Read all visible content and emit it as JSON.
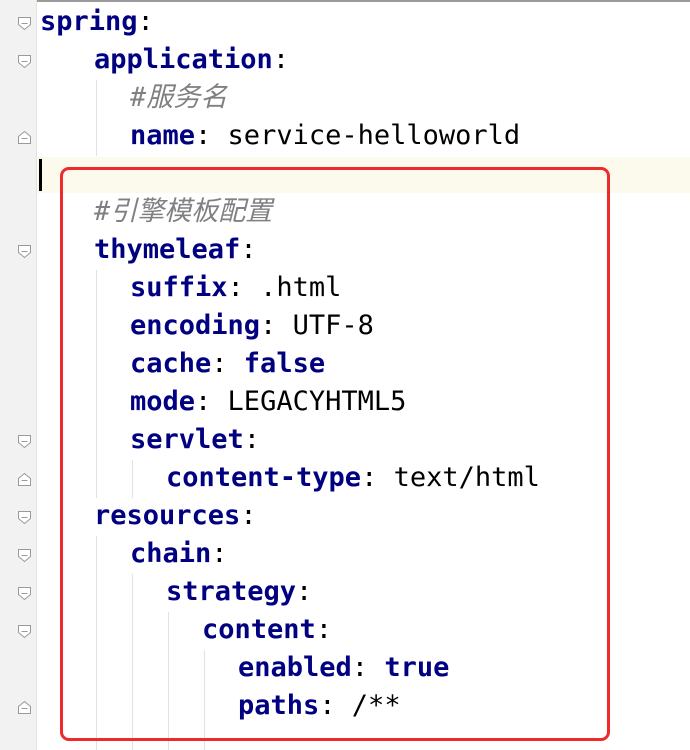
{
  "lines": [
    {
      "key": "spring",
      "colon": ":"
    },
    {
      "key": "application",
      "colon": ":"
    },
    {
      "comment": "#服务名"
    },
    {
      "key": "name",
      "colon": ":",
      "value": " service-helloworld"
    },
    {
      "blank": ""
    },
    {
      "comment": "#引擎模板配置"
    },
    {
      "key": "thymeleaf",
      "colon": ":"
    },
    {
      "key": "suffix",
      "colon": ":",
      "value": " .html"
    },
    {
      "key": "encoding",
      "colon": ":",
      "value": " UTF-8"
    },
    {
      "key": "cache",
      "colon": ":",
      "keyword": " false"
    },
    {
      "key": "mode",
      "colon": ":",
      "value": " LEGACYHTML5"
    },
    {
      "key": "servlet",
      "colon": ":"
    },
    {
      "key": "content-type",
      "colon": ":",
      "value": " text/html"
    },
    {
      "key": "resources",
      "colon": ":"
    },
    {
      "key": "chain",
      "colon": ":"
    },
    {
      "key": "strategy",
      "colon": ":"
    },
    {
      "key": "content",
      "colon": ":"
    },
    {
      "key": "enabled",
      "colon": ":",
      "keyword": " true"
    },
    {
      "key": "paths",
      "colon": ":",
      "value": " /**"
    }
  ],
  "colors": {
    "key": "#000080",
    "comment": "#808080",
    "highlight_box": "#ef2a2a",
    "current_line": "#fcfaed",
    "gutter": "#f2f2f2"
  }
}
